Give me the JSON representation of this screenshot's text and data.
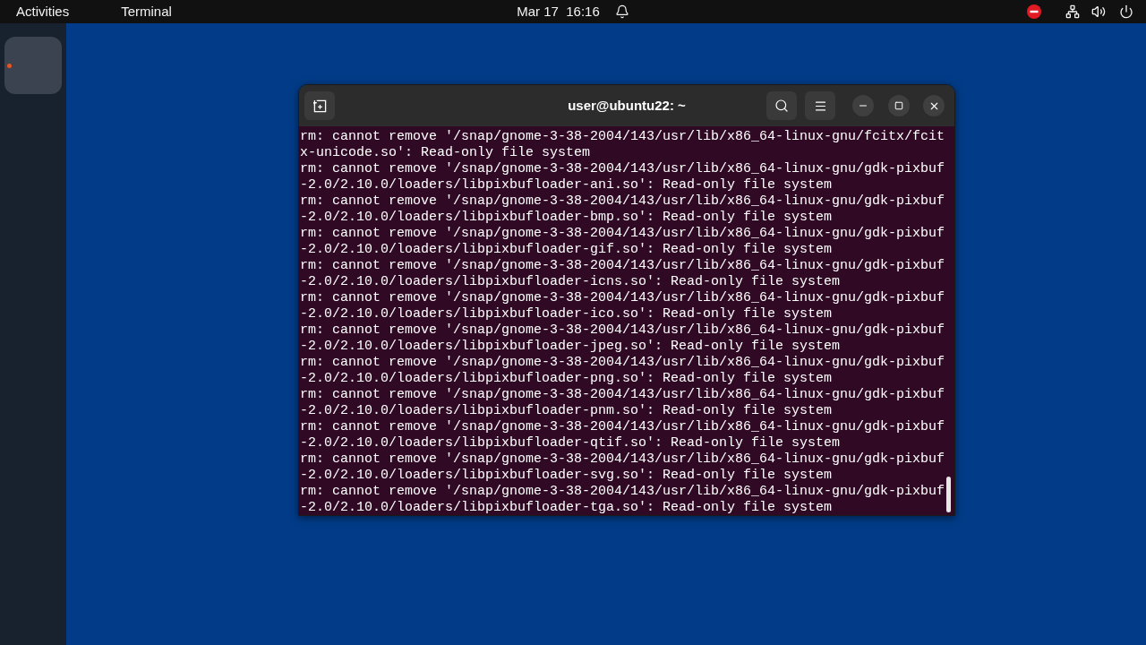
{
  "top_bar": {
    "activities": "Activities",
    "app_menu": "Terminal",
    "clock": "Mar 17  16:16"
  },
  "dock": {
    "apps": [
      {
        "running": true
      }
    ]
  },
  "window": {
    "title": "user@ubuntu22: ~"
  },
  "terminal": {
    "lines": [
      "rm: cannot remove '/snap/gnome-3-38-2004/143/usr/lib/x86_64-linux-gnu/fcitx/fcit",
      "x-unicode.so': Read-only file system",
      "rm: cannot remove '/snap/gnome-3-38-2004/143/usr/lib/x86_64-linux-gnu/gdk-pixbuf",
      "-2.0/2.10.0/loaders/libpixbufloader-ani.so': Read-only file system",
      "rm: cannot remove '/snap/gnome-3-38-2004/143/usr/lib/x86_64-linux-gnu/gdk-pixbuf",
      "-2.0/2.10.0/loaders/libpixbufloader-bmp.so': Read-only file system",
      "rm: cannot remove '/snap/gnome-3-38-2004/143/usr/lib/x86_64-linux-gnu/gdk-pixbuf",
      "-2.0/2.10.0/loaders/libpixbufloader-gif.so': Read-only file system",
      "rm: cannot remove '/snap/gnome-3-38-2004/143/usr/lib/x86_64-linux-gnu/gdk-pixbuf",
      "-2.0/2.10.0/loaders/libpixbufloader-icns.so': Read-only file system",
      "rm: cannot remove '/snap/gnome-3-38-2004/143/usr/lib/x86_64-linux-gnu/gdk-pixbuf",
      "-2.0/2.10.0/loaders/libpixbufloader-ico.so': Read-only file system",
      "rm: cannot remove '/snap/gnome-3-38-2004/143/usr/lib/x86_64-linux-gnu/gdk-pixbuf",
      "-2.0/2.10.0/loaders/libpixbufloader-jpeg.so': Read-only file system",
      "rm: cannot remove '/snap/gnome-3-38-2004/143/usr/lib/x86_64-linux-gnu/gdk-pixbuf",
      "-2.0/2.10.0/loaders/libpixbufloader-png.so': Read-only file system",
      "rm: cannot remove '/snap/gnome-3-38-2004/143/usr/lib/x86_64-linux-gnu/gdk-pixbuf",
      "-2.0/2.10.0/loaders/libpixbufloader-pnm.so': Read-only file system",
      "rm: cannot remove '/snap/gnome-3-38-2004/143/usr/lib/x86_64-linux-gnu/gdk-pixbuf",
      "-2.0/2.10.0/loaders/libpixbufloader-qtif.so': Read-only file system",
      "rm: cannot remove '/snap/gnome-3-38-2004/143/usr/lib/x86_64-linux-gnu/gdk-pixbuf",
      "-2.0/2.10.0/loaders/libpixbufloader-svg.so': Read-only file system",
      "rm: cannot remove '/snap/gnome-3-38-2004/143/usr/lib/x86_64-linux-gnu/gdk-pixbuf",
      "-2.0/2.10.0/loaders/libpixbufloader-tga.so': Read-only file system"
    ]
  }
}
